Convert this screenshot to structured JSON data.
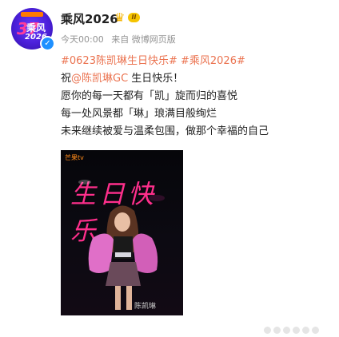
{
  "avatar": {
    "num": "37",
    "name": "乘风",
    "year": "2026"
  },
  "user": {
    "name": "乘风2026",
    "vip_level": "II",
    "follow": ""
  },
  "meta": {
    "time": "今天00:00",
    "source": "来自 微博网页版"
  },
  "post": {
    "topics": "#0623陈凯琳生日快乐# #乘风2026#",
    "line1_prefix": "祝",
    "line1_mention": "@陈凯琳GC",
    "line1_suffix": " 生日快乐！",
    "line2": "愿你的每一天都有「凯」旋而归的喜悦",
    "line3": "每一处风景都「琳」琅满目般绚烂",
    "line4": "未来继续被爱与温柔包围，做那个幸福的自己"
  },
  "poster": {
    "logo": "芒果tv",
    "headline": "生日快乐",
    "signature": "陈凯琳"
  },
  "colors": {
    "accent": "#eb7350",
    "poster_pink": "#ff2f8c",
    "verify_blue": "#1e90ff"
  }
}
